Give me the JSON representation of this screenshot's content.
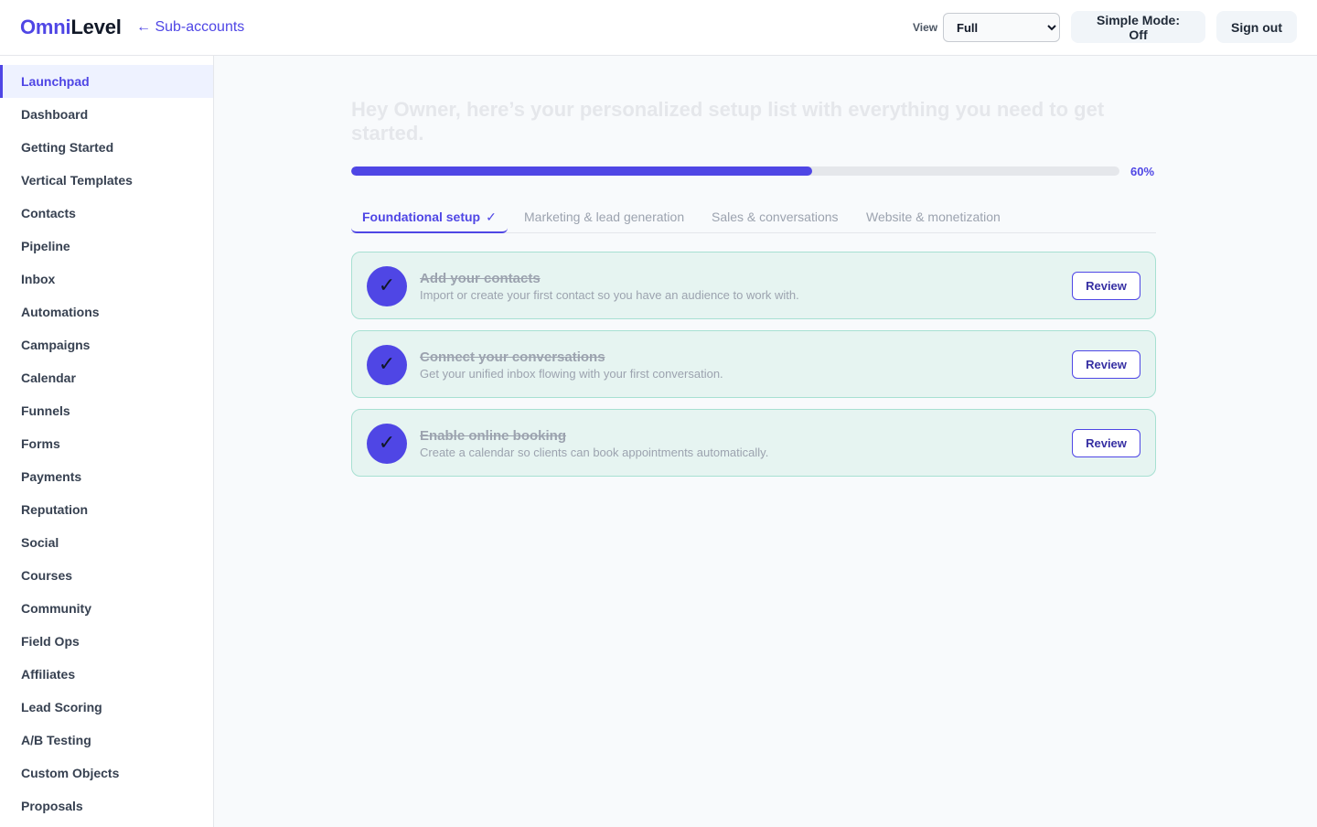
{
  "header": {
    "logo_part1": "Omni",
    "logo_part2": "Level",
    "back_link": "← Sub-accounts",
    "view_label": "View",
    "view_options": [
      "Full"
    ],
    "view_selected": "Full",
    "simple_mode_label": "Simple Mode: Off",
    "signout_label": "Sign out"
  },
  "sidebar": {
    "items": [
      {
        "label": "Launchpad",
        "active": true
      },
      {
        "label": "Dashboard"
      },
      {
        "label": "Getting Started"
      },
      {
        "label": "Vertical Templates"
      },
      {
        "label": "Contacts"
      },
      {
        "label": "Pipeline"
      },
      {
        "label": "Inbox"
      },
      {
        "label": "Automations"
      },
      {
        "label": "Campaigns"
      },
      {
        "label": "Calendar"
      },
      {
        "label": "Funnels"
      },
      {
        "label": "Forms"
      },
      {
        "label": "Payments"
      },
      {
        "label": "Reputation"
      },
      {
        "label": "Social"
      },
      {
        "label": "Courses"
      },
      {
        "label": "Community"
      },
      {
        "label": "Field Ops"
      },
      {
        "label": "Affiliates"
      },
      {
        "label": "Lead Scoring"
      },
      {
        "label": "A/B Testing"
      },
      {
        "label": "Custom Objects"
      },
      {
        "label": "Proposals"
      }
    ]
  },
  "main": {
    "headline": "Hey Owner, here’s your personalized setup list with everything you need to get started.",
    "progress": {
      "value": 60,
      "label": "60%"
    },
    "tabs": [
      {
        "label": "Foundational setup",
        "check": "✓",
        "active": true
      },
      {
        "label": "Marketing & lead generation"
      },
      {
        "label": "Sales & conversations"
      },
      {
        "label": "Website & monetization"
      }
    ],
    "tasks": [
      {
        "title": "Add your contacts",
        "description": "Import or create your first contact so you have an audience to work with.",
        "done_mark": "✓",
        "button": "Review"
      },
      {
        "title": "Connect your conversations",
        "description": "Get your unified inbox flowing with your first conversation.",
        "done_mark": "✓",
        "button": "Review"
      },
      {
        "title": "Enable online booking",
        "description": "Create a calendar so clients can book appointments automatically.",
        "done_mark": "✓",
        "button": "Review"
      }
    ]
  },
  "colors": {
    "accent": "#4f46e5",
    "card_bg": "#e6f4f1",
    "card_border": "#a7e0d2"
  }
}
